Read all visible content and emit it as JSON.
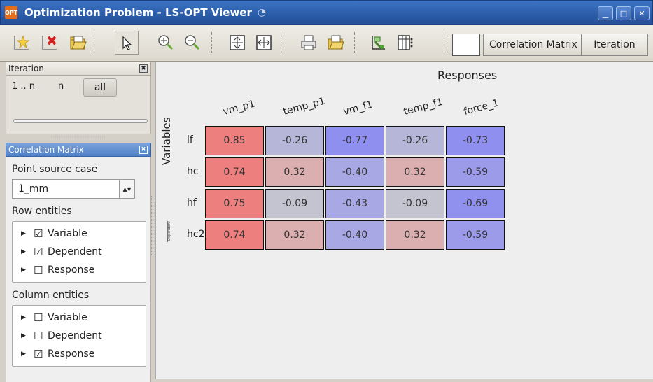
{
  "window": {
    "title": "Optimization Problem - LS-OPT Viewer",
    "app_icon_text": "OPT"
  },
  "toolbar": {
    "correlation_tab": "Correlation Matrix",
    "iteration_tab": "Iteration"
  },
  "iteration_panel": {
    "title": "Iteration",
    "opt_range": "1 .. n",
    "opt_n": "n",
    "opt_all": "all"
  },
  "correlation_panel": {
    "title": "Correlation Matrix",
    "point_source_label": "Point source case",
    "point_source_value": "1_mm",
    "row_entities_label": "Row entities",
    "row_entities": [
      {
        "label": "Variable",
        "checked": true
      },
      {
        "label": "Dependent",
        "checked": true
      },
      {
        "label": "Response",
        "checked": false
      }
    ],
    "column_entities_label": "Column entities",
    "column_entities": [
      {
        "label": "Variable",
        "checked": false
      },
      {
        "label": "Dependent",
        "checked": false
      },
      {
        "label": "Response",
        "checked": true
      }
    ]
  },
  "matrix": {
    "title": "Responses",
    "row_group_label": "Variables",
    "dependent_group_label": "Dependent",
    "columns": [
      "vm_p1",
      "temp_p1",
      "vm_f1",
      "temp_f1",
      "force_1"
    ],
    "rows": [
      "lf",
      "hc",
      "hf",
      "hc2"
    ],
    "values": [
      [
        "0.85",
        "-0.26",
        "-0.77",
        "-0.26",
        "-0.73"
      ],
      [
        "0.74",
        "0.32",
        "-0.40",
        "0.32",
        "-0.59"
      ],
      [
        "0.75",
        "-0.09",
        "-0.43",
        "-0.09",
        "-0.69"
      ],
      [
        "0.74",
        "0.32",
        "-0.40",
        "0.32",
        "-0.59"
      ]
    ],
    "colors": [
      [
        "#ee7f7f",
        "#b6b6d8",
        "#8f8ff0",
        "#b6b6d8",
        "#8f8ff0"
      ],
      [
        "#ee7f7f",
        "#dbafaf",
        "#a8a8e4",
        "#dbafaf",
        "#9b9bea"
      ],
      [
        "#ee7f7f",
        "#c4c4d0",
        "#a8a8e4",
        "#c4c4d0",
        "#9090ee"
      ],
      [
        "#ee7f7f",
        "#dbafaf",
        "#a8a8e4",
        "#dbafaf",
        "#9b9bea"
      ]
    ]
  }
}
